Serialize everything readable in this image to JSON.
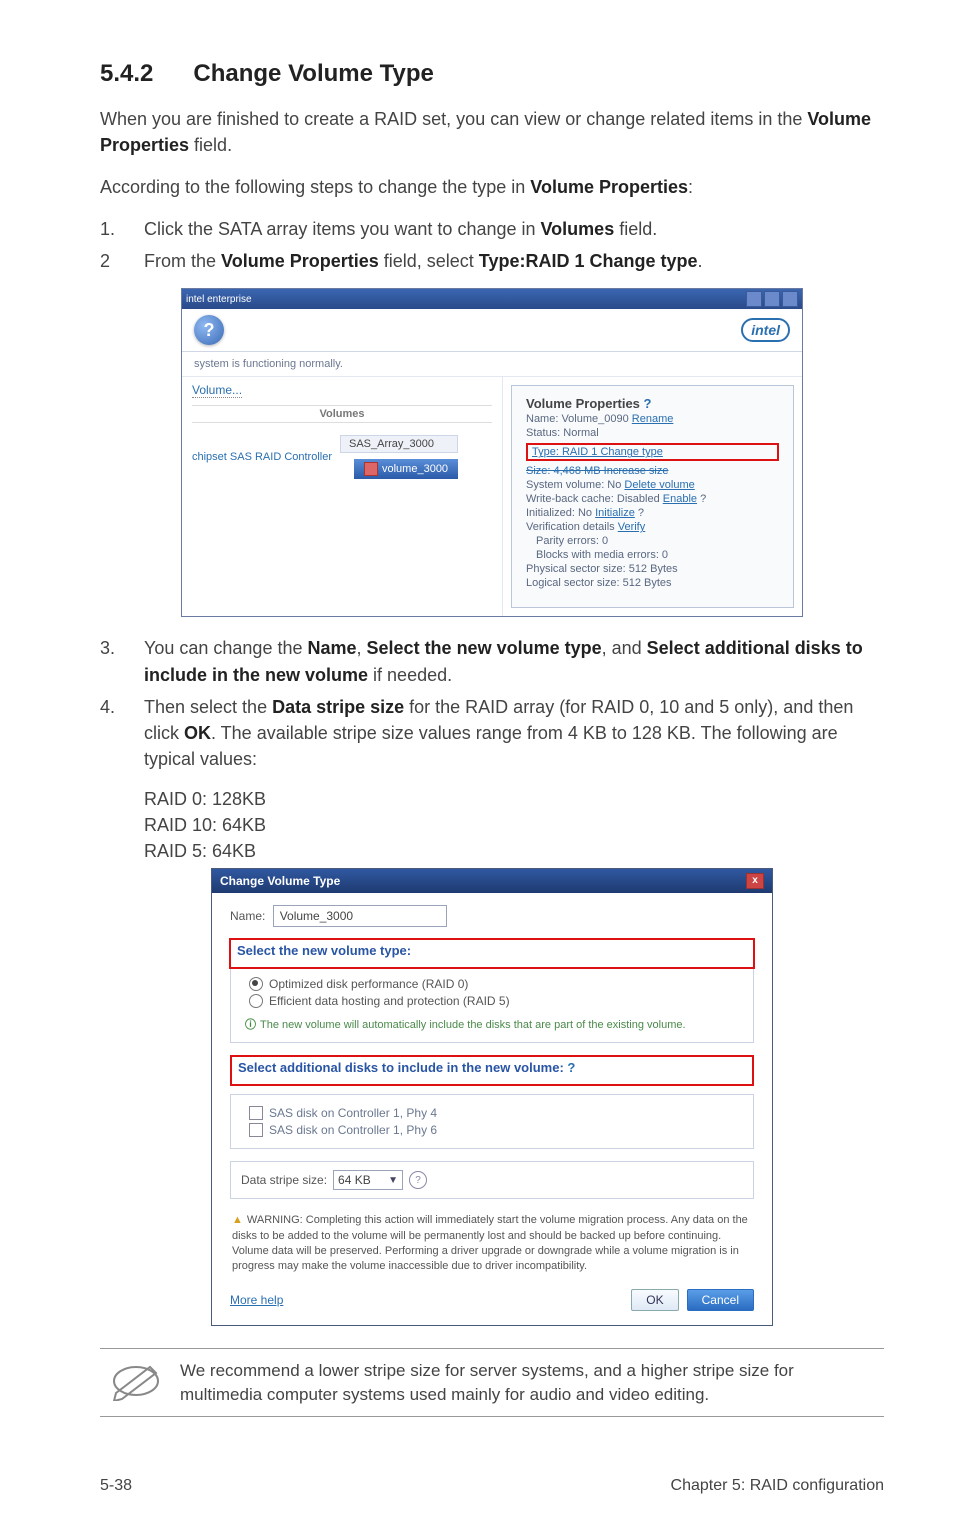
{
  "section": {
    "number": "5.4.2",
    "title": "Change Volume Type"
  },
  "intro1a": "When you are finished to create a RAID set, you can view or change related items in the ",
  "intro1b": "Volume Properties",
  "intro1c": " field.",
  "intro2a": "According to the following steps to change the type in ",
  "intro2b": "Volume Properties",
  "intro2c": ":",
  "step1": {
    "n": "1.",
    "a": "Click the SATA array items you want to change in ",
    "b": "Volumes",
    "c": " field."
  },
  "step2": {
    "n": "2",
    "a": "From the ",
    "b": "Volume Properties",
    "c": " field, select ",
    "d": "Type:RAID 1 Change type",
    "e": "."
  },
  "win1": {
    "titlebar": "intel enterprise",
    "logo_q": "?",
    "intel": "intel",
    "status": "system is functioning normally.",
    "volume_link": "Volume...",
    "vol_header": "Volumes",
    "ctrl_label": "chipset SAS RAID Controller",
    "array_chip": "SAS_Array_3000",
    "vol_chip": "volume_3000",
    "props": {
      "hdr": "Volume Properties",
      "q": "?",
      "name_label": "Name: Volume_0090 ",
      "rename": "Rename",
      "status": "Status: Normal",
      "type_line": "Type: RAID 1 Change type",
      "size_line": "Size: 4,468 MB Increase size",
      "sysvol": "System volume: No ",
      "sysvol_link": "Delete volume",
      "wb": "Write-back cache: Disabled ",
      "wb_link": "Enable",
      "init": "Initialized: No ",
      "init_link": "Initialize",
      "verify": "Verification details ",
      "verify_link": "Verify",
      "parity": "Parity errors: 0",
      "blocks": "Blocks with media errors: 0",
      "physical": "Physical sector size: 512 Bytes",
      "logical": "Logical sector size: 512 Bytes"
    }
  },
  "step3": {
    "n": "3.",
    "a": "You can change the ",
    "b": "Name",
    "c": ", ",
    "d": "Select the new volume type",
    "e": ", and ",
    "f": "Select additional disks to include in the new volume",
    "g": " if needed."
  },
  "step4": {
    "n": "4.",
    "a": "Then select the ",
    "b": "Data stripe size",
    "c": " for the RAID array (for RAID 0, 10 and 5 only), and then click ",
    "d": "OK",
    "e": ". The available stripe size values range from 4 KB to 128 KB. The following are typical values:"
  },
  "raid_lines": {
    "r0": "RAID 0: 128KB",
    "r10": "RAID 10: 64KB",
    "r5": "RAID 5: 64KB"
  },
  "dlg2": {
    "title": "Change Volume Type",
    "name_label": "Name:",
    "name_value": "Volume_3000",
    "group1_title": "Select the new volume type:",
    "opt1": "Optimized disk performance (RAID 0)",
    "opt2": "Efficient data hosting and protection (RAID 5)",
    "info": "The new volume will automatically include the disks that are part of the existing volume.",
    "group2_title": "Select additional disks to include in the new volume:",
    "chk1": "SAS disk on Controller 1, Phy 4",
    "chk2": "SAS disk on Controller 1, Phy 6",
    "stripe_label": "Data stripe size:",
    "stripe_value": "64 KB",
    "warning": "WARNING: Completing this action will immediately start the volume migration process. Any data on the disks to be added to the volume will be permanently lost and should be backed up before continuing. Volume data will be preserved. Performing a driver upgrade or downgrade while a volume migration is in progress may make the volume inaccessible due to driver incompatibility.",
    "more_help": "More help",
    "ok": "OK",
    "cancel": "Cancel"
  },
  "note": "We recommend a lower stripe size for server systems, and a higher stripe size for multimedia computer systems used mainly for audio and video editing.",
  "footer": {
    "left": "5-38",
    "right": "Chapter 5: RAID configuration"
  }
}
